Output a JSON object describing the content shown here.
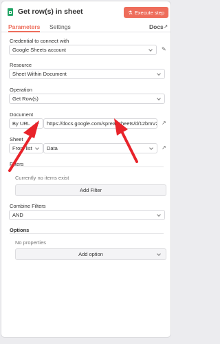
{
  "header": {
    "title": "Get row(s) in sheet",
    "execute_label": "Execute step",
    "colors": {
      "accent": "#ee6d5b",
      "sheets_icon": "#23a566"
    }
  },
  "tabs": [
    {
      "label": "Parameters",
      "active": true
    },
    {
      "label": "Settings",
      "active": false
    }
  ],
  "docs_label": "Docs",
  "fields": {
    "credential": {
      "label": "Credential to connect with",
      "value": "Google Sheets account"
    },
    "resource": {
      "label": "Resource",
      "value": "Sheet Within Document"
    },
    "operation": {
      "label": "Operation",
      "value": "Get Row(s)"
    },
    "document": {
      "label": "Document",
      "mode": "By URL",
      "value": "https://docs.google.com/spreadsheets/d/12bmV2v"
    },
    "sheet": {
      "label": "Sheet",
      "mode": "From list",
      "value": "Data"
    }
  },
  "filters": {
    "label": "Filters",
    "empty_text": "Currently no items exist",
    "add_label": "Add Filter"
  },
  "combine_filters": {
    "label": "Combine Filters",
    "value": "AND"
  },
  "options": {
    "label": "Options",
    "empty_text": "No properties",
    "add_label": "Add option"
  },
  "annotation_color": "#e8232a"
}
